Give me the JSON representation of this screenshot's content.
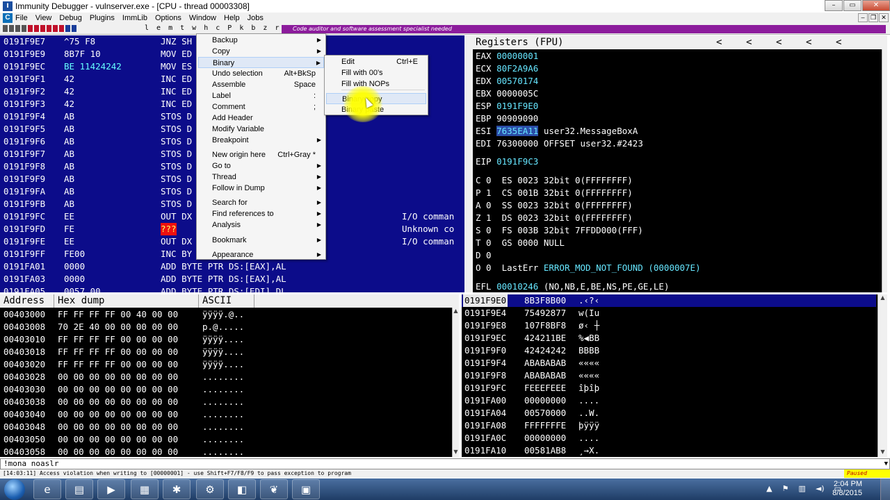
{
  "window": {
    "title": "Immunity Debugger - vulnserver.exe - [CPU - thread 00003308]",
    "app_icon": "immunity-icon",
    "controls": [
      "–",
      "▭",
      "✕"
    ]
  },
  "menu": {
    "items": [
      "File",
      "View",
      "Debug",
      "Plugins",
      "ImmLib",
      "Options",
      "Window",
      "Help",
      "Jobs"
    ]
  },
  "toolbar": {
    "letters": "l e m t w h c P k b z r . . . s ?",
    "banner": "Code auditor and software assessment specialist needed"
  },
  "cpu_rows": [
    {
      "addr": "0191F9E7",
      "hex": "^75 F8",
      "dis": "JNZ SH",
      "cmt": ""
    },
    {
      "addr": "0191F9E9",
      "hex": "8B7F 10",
      "dis": "MOV ED",
      "cmt": ""
    },
    {
      "addr": "0191F9EC",
      "hex": "BE 11424242",
      "dis": "MOV ES",
      "cmt": ""
    },
    {
      "addr": "0191F9F1",
      "hex": "42",
      "dis": "INC ED",
      "cmt": ""
    },
    {
      "addr": "0191F9F2",
      "hex": "42",
      "dis": "INC ED",
      "cmt": ""
    },
    {
      "addr": "0191F9F3",
      "hex": "42",
      "dis": "INC ED",
      "cmt": ""
    },
    {
      "addr": "0191F9F4",
      "hex": "AB",
      "dis": "STOS D",
      "cmt": ""
    },
    {
      "addr": "0191F9F5",
      "hex": "AB",
      "dis": "STOS D",
      "cmt": ""
    },
    {
      "addr": "0191F9F6",
      "hex": "AB",
      "dis": "STOS D",
      "cmt": ""
    },
    {
      "addr": "0191F9F7",
      "hex": "AB",
      "dis": "STOS D",
      "cmt": ""
    },
    {
      "addr": "0191F9F8",
      "hex": "AB",
      "dis": "STOS D",
      "cmt": ""
    },
    {
      "addr": "0191F9F9",
      "hex": "AB",
      "dis": "STOS D",
      "cmt": ""
    },
    {
      "addr": "0191F9FA",
      "hex": "AB",
      "dis": "STOS D",
      "cmt": ""
    },
    {
      "addr": "0191F9FB",
      "hex": "AB",
      "dis": "STOS D",
      "cmt": ""
    },
    {
      "addr": "0191F9FC",
      "hex": "EE",
      "dis": "OUT DX",
      "cmt": "I/O comman"
    },
    {
      "addr": "0191F9FD",
      "hex": "FE",
      "dis": "???",
      "cmt": "Unknown co"
    },
    {
      "addr": "0191F9FE",
      "hex": "EE",
      "dis": "OUT DX",
      "cmt": "I/O comman"
    },
    {
      "addr": "0191F9FF",
      "hex": "FE00",
      "dis": "INC BY",
      "cmt": ""
    },
    {
      "addr": "0191FA01",
      "hex": "0000",
      "dis": "ADD BYTE PTR DS:[EAX],AL",
      "cmt": ""
    },
    {
      "addr": "0191FA03",
      "hex": "0000",
      "dis": "ADD BYTE PTR DS:[EAX],AL",
      "cmt": ""
    },
    {
      "addr": "0191FA05",
      "hex": "0057 00",
      "dis": "ADD BYTE PTR DS:[EDI],DL",
      "cmt": ""
    }
  ],
  "registers": {
    "header": "Registers (FPU)",
    "header_arrows": [
      "<",
      "<",
      "<",
      "<",
      "<",
      "<"
    ],
    "gp": [
      {
        "name": "EAX",
        "value": "00000001",
        "extra": ""
      },
      {
        "name": "ECX",
        "value": "80F2A9A6",
        "extra": ""
      },
      {
        "name": "EDX",
        "value": "00570174",
        "extra": ""
      },
      {
        "name": "EBX",
        "value": "0000005C",
        "extra": ""
      },
      {
        "name": "ESP",
        "value": "0191F9E0",
        "extra": ""
      },
      {
        "name": "EBP",
        "value": "90909090",
        "extra": ""
      },
      {
        "name": "ESI",
        "value": "7635EA11",
        "extra": "user32.MessageBoxA"
      },
      {
        "name": "EDI",
        "value": "76300000",
        "extra": "OFFSET user32.#2423"
      }
    ],
    "eip": {
      "name": "EIP",
      "value": "0191F9C3"
    },
    "segs": [
      "C 0  ES 0023 32bit 0(FFFFFFFF)",
      "P 1  CS 001B 32bit 0(FFFFFFFF)",
      "A 0  SS 0023 32bit 0(FFFFFFFF)",
      "Z 1  DS 0023 32bit 0(FFFFFFFF)",
      "S 0  FS 003B 32bit 7FFDD000(FFF)",
      "T 0  GS 0000 NULL",
      "D 0"
    ],
    "lasterr": {
      "label": "O 0  LastErr",
      "value": "ERROR_MOD_NOT_FOUND (0000007E)"
    },
    "efl": {
      "label": "EFL",
      "value": "00010246",
      "extra": "(NO,NB,E,BE,NS,PE,GE,LE)"
    }
  },
  "dump": {
    "headers": [
      "Address",
      "Hex dump",
      "ASCII"
    ],
    "rows": [
      {
        "addr": "00403000",
        "hex": "FF FF FF FF 00 40 00 00",
        "ascii": "ÿÿÿÿ.@.."
      },
      {
        "addr": "00403008",
        "hex": "70 2E 40 00 00 00 00 00",
        "ascii": "p.@....."
      },
      {
        "addr": "00403010",
        "hex": "FF FF FF FF 00 00 00 00",
        "ascii": "ÿÿÿÿ...."
      },
      {
        "addr": "00403018",
        "hex": "FF FF FF FF 00 00 00 00",
        "ascii": "ÿÿÿÿ...."
      },
      {
        "addr": "00403020",
        "hex": "FF FF FF FF 00 00 00 00",
        "ascii": "ÿÿÿÿ...."
      },
      {
        "addr": "00403028",
        "hex": "00 00 00 00 00 00 00 00",
        "ascii": "........"
      },
      {
        "addr": "00403030",
        "hex": "00 00 00 00 00 00 00 00",
        "ascii": "........"
      },
      {
        "addr": "00403038",
        "hex": "00 00 00 00 00 00 00 00",
        "ascii": "........"
      },
      {
        "addr": "00403040",
        "hex": "00 00 00 00 00 00 00 00",
        "ascii": "........"
      },
      {
        "addr": "00403048",
        "hex": "00 00 00 00 00 00 00 00",
        "ascii": "........"
      },
      {
        "addr": "00403050",
        "hex": "00 00 00 00 00 00 00 00",
        "ascii": "........"
      },
      {
        "addr": "00403058",
        "hex": "00 00 00 00 00 00 00 00",
        "ascii": "........"
      }
    ]
  },
  "stack": {
    "rows": [
      {
        "addr": "0191F9E0",
        "value": "8B3F8B00",
        "ascii": ".‹?‹"
      },
      {
        "addr": "0191F9E4",
        "value": "75492877",
        "ascii": "w(Iu"
      },
      {
        "addr": "0191F9E8",
        "value": "107F8BF8",
        "ascii": "ø‹ ┼"
      },
      {
        "addr": "0191F9EC",
        "value": "424211BE",
        "ascii": "%◀BB"
      },
      {
        "addr": "0191F9F0",
        "value": "42424242",
        "ascii": "BBBB"
      },
      {
        "addr": "0191F9F4",
        "value": "ABABABAB",
        "ascii": "««««"
      },
      {
        "addr": "0191F9F8",
        "value": "ABABABAB",
        "ascii": "««««"
      },
      {
        "addr": "0191F9FC",
        "value": "FEEEFEEE",
        "ascii": "îþîþ"
      },
      {
        "addr": "0191FA00",
        "value": "00000000",
        "ascii": "...."
      },
      {
        "addr": "0191FA04",
        "value": "00570000",
        "ascii": "..W."
      },
      {
        "addr": "0191FA08",
        "value": "FFFFFFFE",
        "ascii": "þÿÿÿ"
      },
      {
        "addr": "0191FA0C",
        "value": "00000000",
        "ascii": "...."
      },
      {
        "addr": "0191FA10",
        "value": "00581AB8",
        "ascii": "¸→X."
      }
    ]
  },
  "command": {
    "value": "!mona noaslr"
  },
  "status": {
    "message": "[14:03:11] Access violation when writing to [00000001] - use Shift+F7/F8/F9 to pass exception to program",
    "state": "Paused"
  },
  "context_menu": {
    "items": [
      {
        "label": "Backup",
        "shortcut": "",
        "submenu": true
      },
      {
        "label": "Copy",
        "shortcut": "",
        "submenu": true
      },
      {
        "label": "Binary",
        "shortcut": "",
        "submenu": true
      },
      {
        "label": "Undo selection",
        "shortcut": "Alt+BkSp",
        "submenu": false
      },
      {
        "label": "Assemble",
        "shortcut": "Space",
        "submenu": false
      },
      {
        "label": "Label",
        "shortcut": ":",
        "submenu": false
      },
      {
        "label": "Comment",
        "shortcut": ";",
        "submenu": false
      },
      {
        "label": "Add Header",
        "shortcut": "",
        "submenu": false
      },
      {
        "label": "Modify Variable",
        "shortcut": "",
        "submenu": false
      },
      {
        "label": "Breakpoint",
        "shortcut": "",
        "submenu": true
      },
      {
        "label": "New origin here",
        "shortcut": "Ctrl+Gray *",
        "submenu": false
      },
      {
        "label": "Go to",
        "shortcut": "",
        "submenu": true
      },
      {
        "label": "Thread",
        "shortcut": "",
        "submenu": true
      },
      {
        "label": "Follow in Dump",
        "shortcut": "",
        "submenu": true
      },
      {
        "label": "Search for",
        "shortcut": "",
        "submenu": true
      },
      {
        "label": "Find references to",
        "shortcut": "",
        "submenu": true
      },
      {
        "label": "Analysis",
        "shortcut": "",
        "submenu": true
      },
      {
        "label": "Bookmark",
        "shortcut": "",
        "submenu": true
      },
      {
        "label": "Appearance",
        "shortcut": "",
        "submenu": true
      }
    ]
  },
  "binary_submenu": {
    "items": [
      {
        "label": "Edit",
        "shortcut": "Ctrl+E"
      },
      {
        "label": "Fill with 00's",
        "shortcut": ""
      },
      {
        "label": "Fill with NOPs",
        "shortcut": ""
      },
      {
        "label": "Binary copy",
        "shortcut": ""
      },
      {
        "label": "Binary paste",
        "shortcut": ""
      }
    ]
  },
  "taskbar": {
    "apps": [
      "internet-explorer-icon",
      "folder-icon",
      "media-player-icon",
      "notepad-icon",
      "immunity-icon",
      "process-icon",
      "file-icon",
      "tool-icon",
      "window-icon"
    ],
    "time": "2:04 PM",
    "date": "8/8/2015"
  },
  "colors": {
    "cpu_bg": "#0c0c8a",
    "panel_bg": "#000000",
    "register_value": "#66e6ff",
    "banner": "#8c1c9c",
    "paused_bg": "#ffff00"
  }
}
